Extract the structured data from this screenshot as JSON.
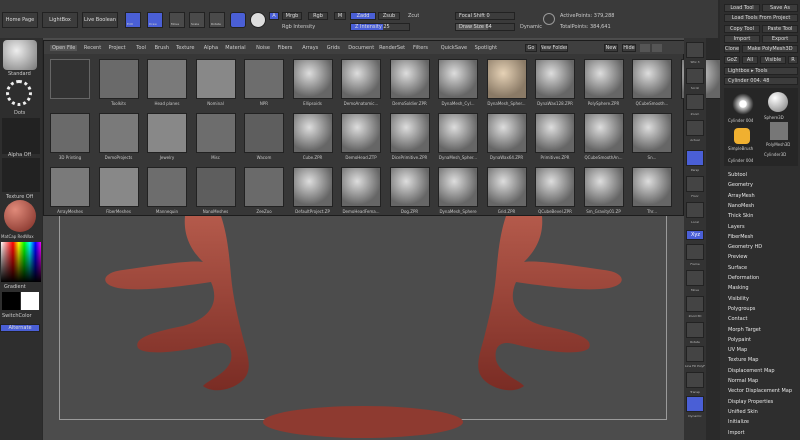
{
  "topbar": {
    "home_page": "Home Page",
    "lightbox": "LightBox",
    "live_boolean": "Live Boolean",
    "edit": "Edit",
    "draw": "Draw",
    "move": "Move",
    "scale": "Scale",
    "rotate": "Rotate",
    "a": "A",
    "mrgb": "Mrgb",
    "rgb": "Rgb",
    "m": "M",
    "rgb_intensity": "Rgb Intensity",
    "zadd": "Zadd",
    "zsub": "Zsub",
    "zcut": "Zcut",
    "z_intensity": "Z Intensity 25",
    "focal_shift": "Focal Shift 0",
    "draw_size": "Draw Size 64",
    "dynamic": "Dynamic",
    "active_points": "ActivePoints: 379,288",
    "total_points": "TotalPoints: 384,641"
  },
  "left": {
    "standard": "Standard",
    "dots": "Dots",
    "alpha_off": "Alpha Off",
    "texture_off": "Texture Off",
    "material": "MatCap RedWax",
    "gradient": "Gradient",
    "switch_color": "SwitchColor",
    "alternate": "Alternate"
  },
  "lightbox": {
    "tabs": [
      "Open File",
      "Recent",
      "Project",
      "Tool",
      "Brush",
      "Texture",
      "Alpha",
      "Material",
      "Noise",
      "Fibers",
      "Arrays",
      "Grids",
      "Document",
      "RenderSet",
      "Filters",
      "QuickSave",
      "Spotlight"
    ],
    "go": "Go",
    "new_folder": "New Folder",
    "new": "New",
    "hide": "Hide",
    "rows": [
      [
        "",
        "Toolkits",
        "Head planes",
        "Nominal",
        "NPR",
        "Ellipsoids",
        "DemoAnatomic...",
        "DemoSoldier.ZPR",
        "DynaMesh_Cyl...",
        "DynaMesh_Spher...",
        "DynaWax128.ZPR",
        "PolySphere.ZPR",
        "QCubeSmooth...",
        "Sn..."
      ],
      [
        "3D Printing",
        "DemoProjects",
        "Jewelry",
        "Misc",
        "Wacom",
        "Cube.ZPR",
        "DemoHead.ZTP",
        "DicePrimitive.ZPR",
        "DynaMesh_Spher...",
        "DynaWax64.ZPR",
        "Primitives.ZPR",
        "QCubeSmoothAn...",
        "Sn..."
      ],
      [
        "ArrayMeshes",
        "FiberMeshes",
        "Mannequin",
        "NanoMeshes",
        "ZeeZoo",
        "DefaultProject.ZP",
        "DemoHeadFema...",
        "Dog.ZPR",
        "DynaMesh_Sphere",
        "Grid.ZPR",
        "QCubeBevel.ZPR",
        "Sm_Gravity01.ZP",
        "Thr..."
      ]
    ]
  },
  "shelf": {
    "spix": "SPix 3",
    "scroll": "Scroll",
    "zoom": "Zoom",
    "actual": "Actual",
    "aahalf": "AAHalf",
    "persp": "Persp",
    "floor": "Floor",
    "local": "Local",
    "xyz": "Xyz",
    "frame": "Frame",
    "move": "Move",
    "zoom3d": "Zoom3D",
    "rotate": "Rotate",
    "polyf": "Line Fill PolyF",
    "transp": "Transp",
    "ghost": "Ghost",
    "solo": "Solo",
    "xpose": "Xpose",
    "dynamic": "Dynamic"
  },
  "right": {
    "load_tool": "Load Tool",
    "save_as": "Save As",
    "load_tools_project": "Load Tools From Project",
    "copy_tool": "Copy Tool",
    "paste_tool": "Paste Tool",
    "import": "Import",
    "export": "Export",
    "clone": "Clone",
    "make_polymesh": "Make PolyMesh3D",
    "goz": "GoZ",
    "all": "All",
    "visible": "Visible",
    "r": "R",
    "lightbox_tools": "Lightbox ▸ Tools",
    "current_tool": "Cylinder 004. 48",
    "tools": [
      "Cylinder 004",
      "Sphere3D",
      "PolyMesh3D",
      "SimpleBrush",
      "Cylinder3D",
      "Cylinder 004"
    ],
    "subpalettes": [
      "Subtool",
      "Geometry",
      "ArrayMesh",
      "NanoMesh",
      "Thick Skin",
      "Layers",
      "FiberMesh",
      "Geometry HD",
      "Preview",
      "Surface",
      "Deformation",
      "Masking",
      "Visibility",
      "Polygroups",
      "Contact",
      "Morph Target",
      "Polypaint",
      "UV Map",
      "Texture Map",
      "Displacement Map",
      "Normal Map",
      "Vector Displacement Map",
      "Display Properties",
      "Unified Skin",
      "Initialize",
      "Import"
    ]
  },
  "colors": {
    "accent": "#4a5fd6",
    "wax": "#a84a3e",
    "bg": "#2a2a2a"
  }
}
